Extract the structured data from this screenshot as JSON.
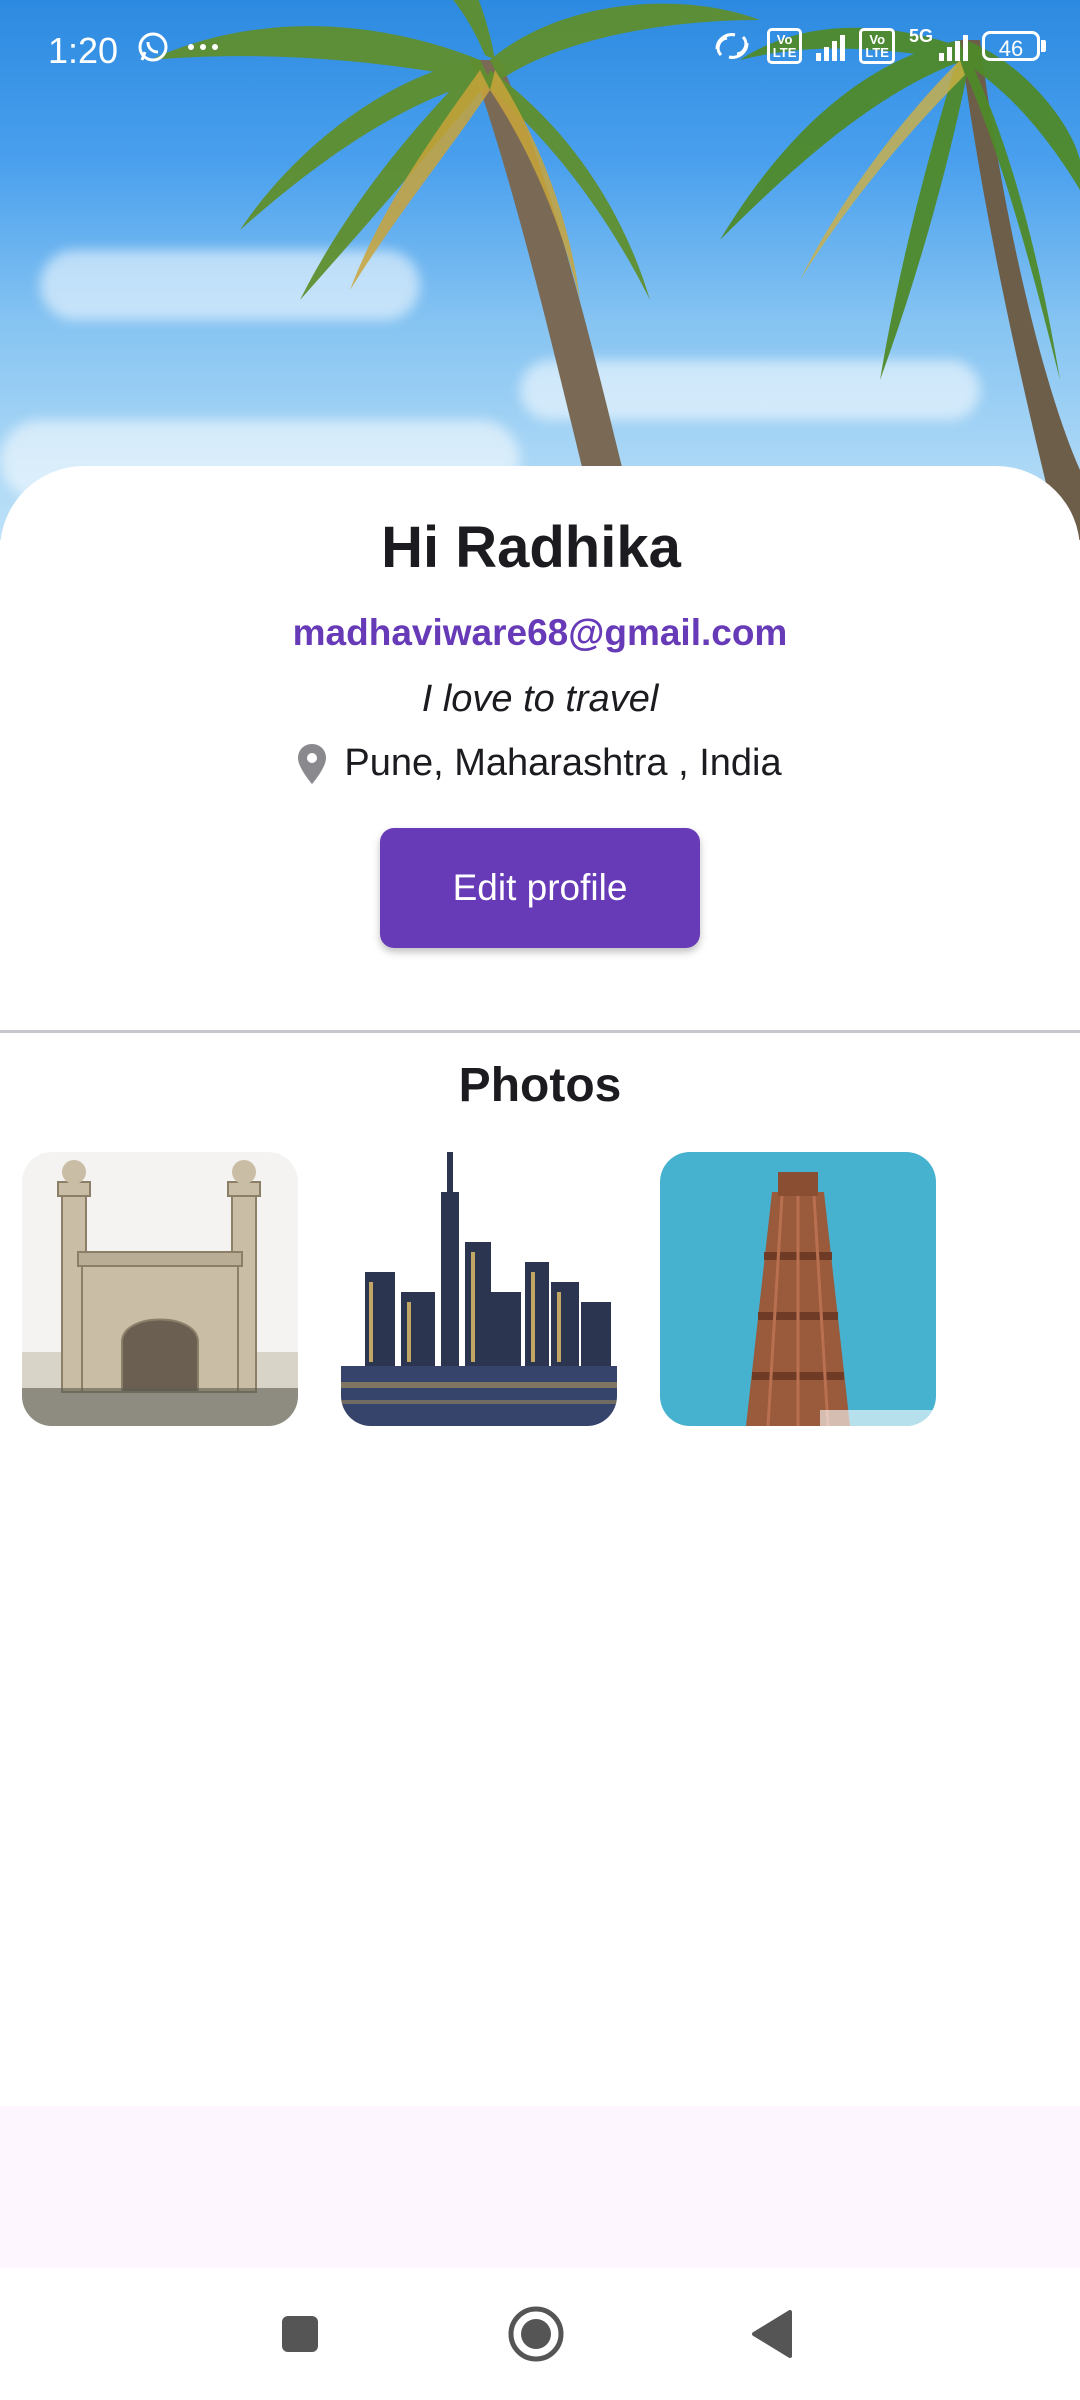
{
  "status_bar": {
    "time": "1:20",
    "network_type": "5G",
    "volte_label": "Vo\nLTE",
    "battery_level": "46"
  },
  "profile": {
    "greeting": "Hi Radhika",
    "email": "madhaviware68@gmail.com",
    "bio": "I love to travel",
    "location": "Pune, Maharashtra , India",
    "edit_button_label": "Edit profile"
  },
  "photos": {
    "section_title": "Photos",
    "items": [
      {
        "subject": "Charminar"
      },
      {
        "subject": "City skyline at night"
      },
      {
        "subject": "Qutub Minar"
      }
    ]
  },
  "colors": {
    "accent": "#673ab7",
    "text": "#1c1b1f",
    "divider": "#c8c5cc"
  },
  "icons": {
    "location": "location-pin-icon",
    "nav_recents": "square-icon",
    "nav_home": "circle-icon",
    "nav_back": "triangle-back-icon"
  }
}
